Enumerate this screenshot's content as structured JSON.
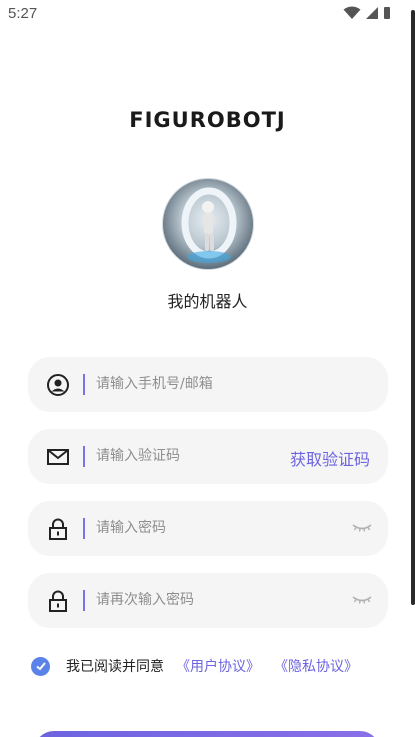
{
  "status": {
    "time": "5:27"
  },
  "brand": {
    "logo_text": "FIGUROBOTJ"
  },
  "profile": {
    "app_name": "我的机器人"
  },
  "form": {
    "account_placeholder": "请输入手机号/邮箱",
    "code_placeholder": "请输入验证码",
    "get_code_label": "获取验证码",
    "password_placeholder": "请输入密码",
    "confirm_password_placeholder": "请再次输入密码"
  },
  "agreement": {
    "checked": true,
    "text": "我已阅读并同意",
    "user_agreement": "《用户协议》",
    "privacy_policy": "《隐私协议》"
  },
  "colors": {
    "accent": "#6d64e0",
    "check": "#5b82e8",
    "field_bg": "#f5f5f5"
  }
}
